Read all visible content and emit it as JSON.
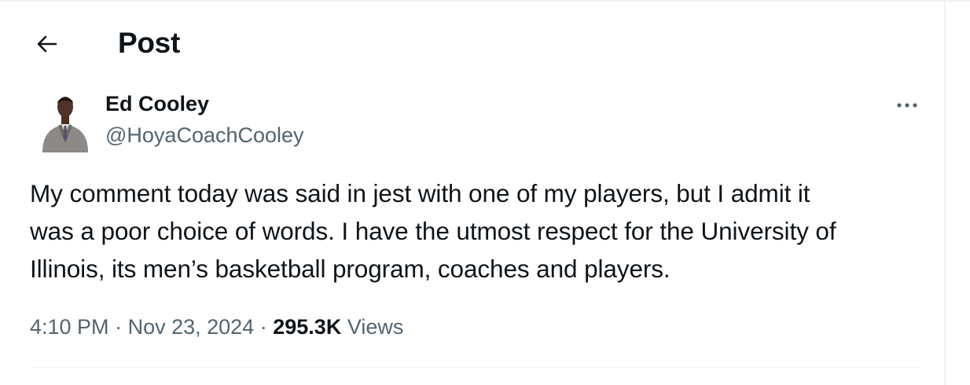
{
  "header": {
    "title": "Post",
    "back_icon": "arrow-left-icon"
  },
  "author": {
    "name": "Ed Cooley",
    "handle": "@HoyaCoachCooley",
    "avatar_alt": "avatar",
    "more_icon": "more-horizontal-icon"
  },
  "tweet": {
    "text": "My comment today was said in jest with one of my players, but I admit it\nwas a poor choice of words. I have the utmost respect for the University of\nIllinois, its men’s basketball program, coaches and players."
  },
  "meta": {
    "time": "4:10 PM",
    "separator": "·",
    "date": "Nov 23, 2024",
    "views_count": "295.3K",
    "views_label": "Views"
  },
  "colors": {
    "text_primary": "#0f1419",
    "text_secondary": "#536471",
    "border": "#eff3f4"
  }
}
